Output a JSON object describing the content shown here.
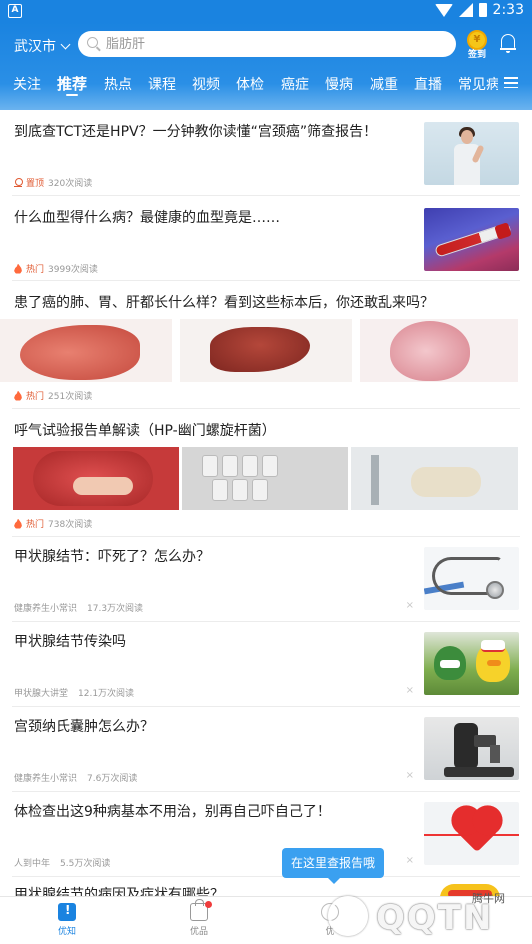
{
  "status_bar": {
    "time": "2:33",
    "app_badge": "A"
  },
  "header": {
    "city": "武汉市",
    "search_placeholder": "脂肪肝",
    "signin_label": "签到",
    "signin_coin": "¥"
  },
  "tabs": [
    {
      "label": "关注"
    },
    {
      "label": "推荐"
    },
    {
      "label": "热点"
    },
    {
      "label": "课程"
    },
    {
      "label": "视频"
    },
    {
      "label": "体检"
    },
    {
      "label": "癌症"
    },
    {
      "label": "慢病"
    },
    {
      "label": "减重"
    },
    {
      "label": "直播"
    },
    {
      "label": "常见病"
    }
  ],
  "feed": [
    {
      "title": "到底查TCT还是HPV？一分钟教你读懂“宫颈癌”筛查报告！",
      "tag": "置顶",
      "reads": "320次阅读"
    },
    {
      "title": "什么血型得什么病？最健康的血型竟是……",
      "tag": "热门",
      "reads": "3999次阅读"
    },
    {
      "title": "患了癌的肺、胃、肝都长什么样？看到这些标本后，你还敢乱来吗？",
      "tag": "热门",
      "reads": "251次阅读"
    },
    {
      "title": "呼气试验报告单解读（HP-幽门螺旋杆菌）",
      "tag": "热门",
      "reads": "738次阅读"
    },
    {
      "title": "甲状腺结节：吓死了？怎么办？",
      "source": "健康养生小常识",
      "reads": "17.3万次阅读"
    },
    {
      "title": "甲状腺结节传染吗",
      "source": "甲状腺大讲堂",
      "reads": "12.1万次阅读"
    },
    {
      "title": "宫颈纳氏囊肿怎么办？",
      "source": "健康养生小常识",
      "reads": "7.6万次阅读"
    },
    {
      "title": "体检查出这9种病基本不用治，别再自己吓自己了！",
      "source": "人到中年",
      "reads": "5.5万次阅读"
    },
    {
      "title": "甲状腺结节的病因及症状有哪些？"
    }
  ],
  "close_glyph": "×",
  "toast": "在这里查报告哦",
  "bottom_nav": [
    {
      "label": "优知"
    },
    {
      "label": "优品"
    },
    {
      "label": "优"
    }
  ],
  "watermark": {
    "text": "QQTN",
    "site": "腾牛网"
  }
}
